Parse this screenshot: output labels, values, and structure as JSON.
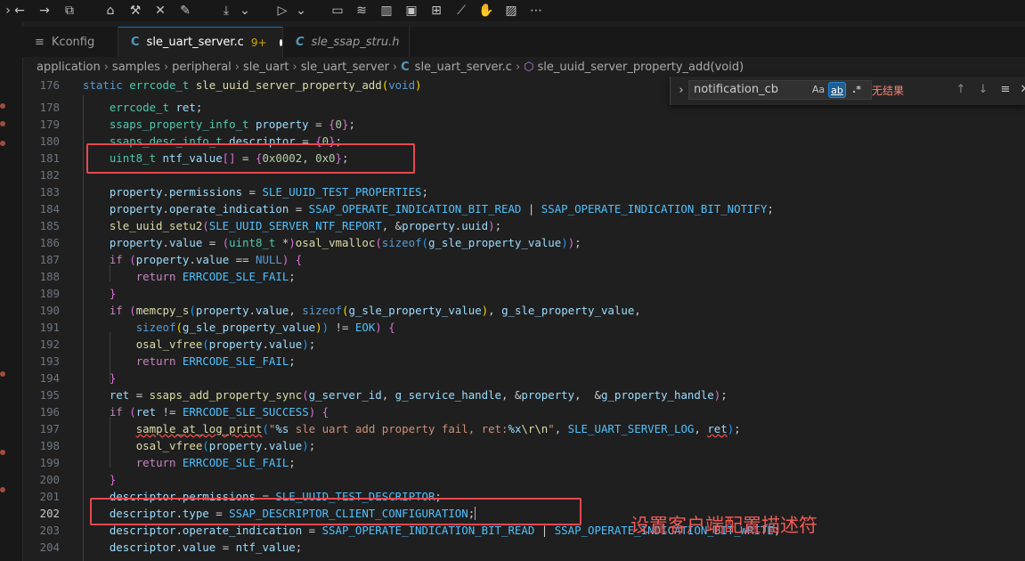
{
  "toolbar": {
    "icons": [
      "back-icon",
      "forward-icon",
      "search-window-icon",
      "home-icon",
      "hammer-icon",
      "tools-icon",
      "clean-icon",
      "download-icon",
      "dropdown-icon",
      "debug-run-icon",
      "dropdown-icon",
      "terminal-icon",
      "layers-icon",
      "chart-icon",
      "chip-icon",
      "device-icon",
      "trend-icon",
      "plugin-icon",
      "image-icon",
      "more-icon"
    ]
  },
  "tabs": [
    {
      "label": "Kconfig"
    },
    {
      "label": "sle_uart_server.c",
      "warnings": "9+"
    },
    {
      "label": "sle_ssap_stru.h"
    }
  ],
  "breadcrumb": {
    "items": [
      "application",
      "samples",
      "peripheral",
      "sle_uart",
      "sle_uart_server",
      "sle_uart_server.c",
      "sle_uuid_server_property_add(void)"
    ]
  },
  "find": {
    "value": "notification_cb",
    "opt_case": "Aa",
    "opt_word": "ab",
    "opt_regex": ".*",
    "no_results": "无结果"
  },
  "editor": {
    "lines": [
      {
        "n": "176",
        "text": "static errcode_t sle_uuid_server_property_add(void)"
      },
      {
        "n": "178",
        "text": "    errcode_t ret;"
      },
      {
        "n": "179",
        "text": "    ssaps_property_info_t property = {0};"
      },
      {
        "n": "180",
        "text": "    ssaps_desc_info_t descriptor = {0};"
      },
      {
        "n": "181",
        "text": "    uint8_t ntf_value[] = {0x0002, 0x0};"
      },
      {
        "n": "182",
        "text": ""
      },
      {
        "n": "183",
        "text": "    property.permissions = SLE_UUID_TEST_PROPERTIES;"
      },
      {
        "n": "184",
        "text": "    property.operate_indication = SSAP_OPERATE_INDICATION_BIT_READ | SSAP_OPERATE_INDICATION_BIT_NOTIFY;"
      },
      {
        "n": "185",
        "text": "    sle_uuid_setu2(SLE_UUID_SERVER_NTF_REPORT, &property.uuid);"
      },
      {
        "n": "186",
        "text": "    property.value = (uint8_t *)osal_vmalloc(sizeof(g_sle_property_value));"
      },
      {
        "n": "187",
        "text": "    if (property.value == NULL) {"
      },
      {
        "n": "188",
        "text": "        return ERRCODE_SLE_FAIL;"
      },
      {
        "n": "189",
        "text": "    }"
      },
      {
        "n": "190",
        "text": "    if (memcpy_s(property.value, sizeof(g_sle_property_value), g_sle_property_value,"
      },
      {
        "n": "191",
        "text": "        sizeof(g_sle_property_value)) != EOK) {"
      },
      {
        "n": "192",
        "text": "        osal_vfree(property.value);"
      },
      {
        "n": "193",
        "text": "        return ERRCODE_SLE_FAIL;"
      },
      {
        "n": "194",
        "text": "    }"
      },
      {
        "n": "195",
        "text": "    ret = ssaps_add_property_sync(g_server_id, g_service_handle, &property,  &g_property_handle);"
      },
      {
        "n": "196",
        "text": "    if (ret != ERRCODE_SLE_SUCCESS) {"
      },
      {
        "n": "197",
        "text": "        sample_at_log_print(\"%s sle uart add property fail, ret:%x\\r\\n\", SLE_UART_SERVER_LOG, ret);"
      },
      {
        "n": "198",
        "text": "        osal_vfree(property.value);"
      },
      {
        "n": "199",
        "text": "        return ERRCODE_SLE_FAIL;"
      },
      {
        "n": "200",
        "text": "    }"
      },
      {
        "n": "201",
        "text": "    descriptor.permissions = SLE_UUID_TEST_DESCRIPTOR;"
      },
      {
        "n": "202",
        "text": "    descriptor.type = SSAP_DESCRIPTOR_CLIENT_CONFIGURATION;"
      },
      {
        "n": "203",
        "text": "    descriptor.operate_indication = SSAP_OPERATE_INDICATION_BIT_READ | SSAP_OPERATE_INDICATION_BIT_WRITE;"
      },
      {
        "n": "204",
        "text": "    descriptor.value = ntf_value;"
      }
    ]
  },
  "annotation": "设置客户端配置描述符",
  "colors": {
    "accent": "#0078d4",
    "highlight_box": "#e8484f",
    "annotation": "#f05a56"
  }
}
